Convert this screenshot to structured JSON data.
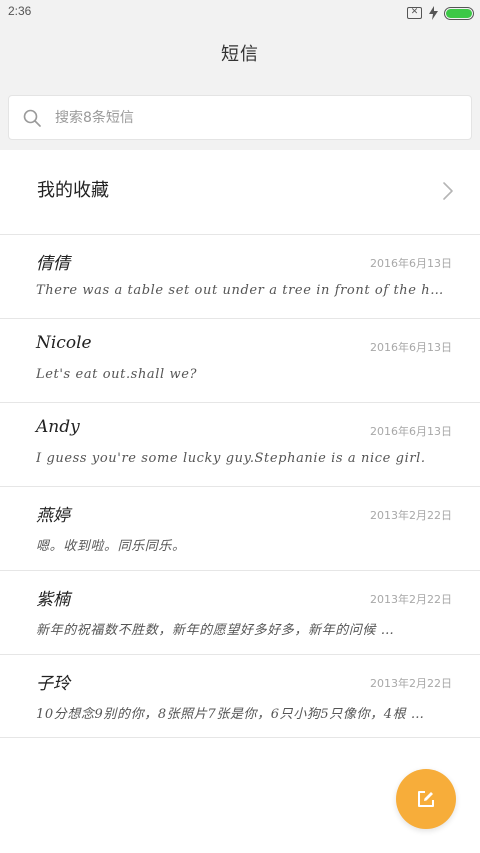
{
  "status_bar": {
    "time": "2:36",
    "sim_symbol": "✕",
    "battery_color": "#3cc846"
  },
  "header": {
    "title": "短信"
  },
  "search": {
    "placeholder": "搜索8条短信"
  },
  "favorites": {
    "label": "我的收藏"
  },
  "messages": [
    {
      "name": "倩倩",
      "date": "2016年6月13日",
      "preview": "There was a table set out under a tree in front of the hous"
    },
    {
      "name": "Nicole",
      "date": "2016年6月13日",
      "preview": "Let's eat out.shall we?"
    },
    {
      "name": "Andy",
      "date": "2016年6月13日",
      "preview": "I guess you're some lucky guy.Stephanie is a nice girl."
    },
    {
      "name": "燕婷",
      "date": "2013年2月22日",
      "preview": "嗯。收到啦。同乐同乐。"
    },
    {
      "name": "紫楠",
      "date": "2013年2月22日",
      "preview": "新年的祝福数不胜数，新年的愿望好多好多，新年的问候 …"
    },
    {
      "name": "子玲",
      "date": "2013年2月22日",
      "preview": "10分想念9别的你，8张照片7张是你，6只小狗5只像你，4根 …"
    }
  ],
  "fab": {
    "color": "#f7ad3a",
    "icon": "compose-icon"
  }
}
